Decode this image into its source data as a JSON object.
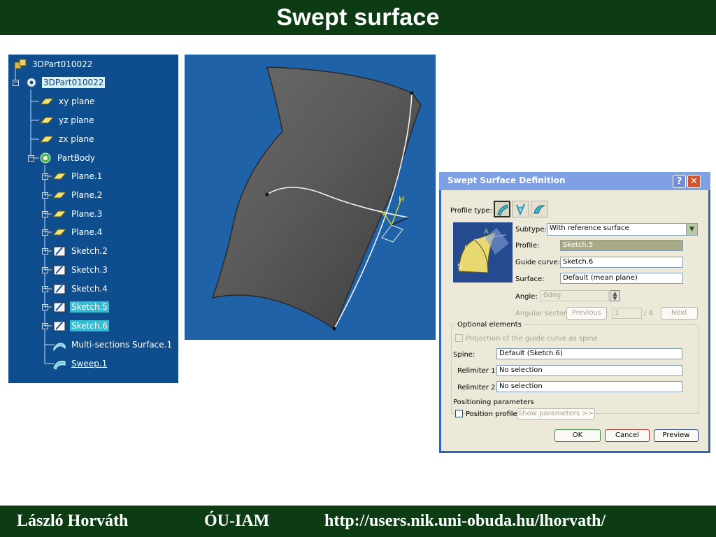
{
  "slide": {
    "title": "Swept surface",
    "footer": {
      "author": "László Horváth",
      "org": "ÓU-IAM",
      "url": "http://users.nik.uni-obuda.hu/lhorvath/"
    }
  },
  "tree": {
    "items": [
      {
        "label": "3DPart010022"
      },
      {
        "label": "3DPart010022"
      },
      {
        "label": "xy plane"
      },
      {
        "label": "yz plane"
      },
      {
        "label": "zx plane"
      },
      {
        "label": "PartBody"
      },
      {
        "label": "Plane.1"
      },
      {
        "label": "Plane.2"
      },
      {
        "label": "Plane.3"
      },
      {
        "label": "Plane.4"
      },
      {
        "label": "Sketch.2"
      },
      {
        "label": "Sketch.3"
      },
      {
        "label": "Sketch.4"
      },
      {
        "label": "Sketch.5"
      },
      {
        "label": "Sketch.6"
      },
      {
        "label": "Multi-sections Surface.1"
      },
      {
        "label": "Sweep.1"
      }
    ],
    "expander_symbols": {
      "expanded": "−",
      "collapsed": "+"
    }
  },
  "viewport": {
    "axis_labels": {
      "a": "H",
      "b": "V"
    }
  },
  "dialog": {
    "title": "Swept Surface Definition",
    "help_symbol": "?",
    "close_symbol": "✕",
    "profile_type_label": "Profile type:",
    "subtype_label": "Subtype:",
    "subtype_value": "With reference surface",
    "profile_label": "Profile:",
    "profile_value": "Sketch.5",
    "guide_label": "Guide curve:",
    "guide_value": "Sketch.6",
    "surface_label": "Surface:",
    "surface_value": "Default (mean plane)",
    "angle_label": "Angle:",
    "angle_value": "0deg",
    "angular_sector_label": "Angular sector:",
    "previous_label": "Previous",
    "sector_value": "1",
    "sector_total": "/ 4",
    "next_label": "Next",
    "optional_title": "Optional elements",
    "projection_label": "Projection of the guide curve as spine",
    "spine_label": "Spine:",
    "spine_value": "Default (Sketch.6)",
    "relimiter1_label": "Relimiter 1:",
    "relimiter1_value": "No selection",
    "relimiter2_label": "Relimiter 2:",
    "relimiter2_value": "No selection",
    "positioning_title": "Positioning parameters",
    "position_profile_label": "Position profile",
    "show_params_label": "Show parameters >>",
    "ok_label": "OK",
    "cancel_label": "Cancel",
    "preview_label": "Preview",
    "preview_image_labels": {
      "a": "A",
      "p": "P",
      "s": "S",
      "g": "G"
    }
  },
  "colors": {
    "header_band": "#0d3c14",
    "tree_bg": "#0e4e8e",
    "viewport_bg": "#1f62a8",
    "dialog_border": "#2f64c4"
  }
}
